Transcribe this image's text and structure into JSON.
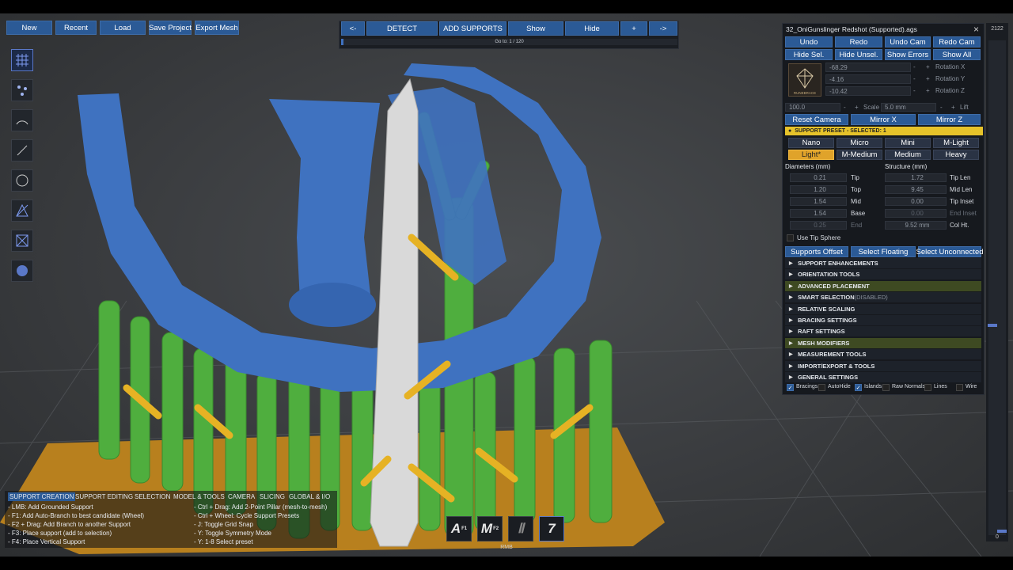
{
  "top_left_buttons": [
    "New",
    "Recent",
    "Load",
    "Save Project",
    "Export Mesh"
  ],
  "detect_bar": {
    "prev": "<-",
    "detect": "DETECT",
    "add_supports": "ADD SUPPORTS",
    "show": "Show",
    "hide": "Hide",
    "plus": "+",
    "next": "->",
    "goto": "Go to: 1 / 120",
    "progress": 0.008
  },
  "panel": {
    "title": "32_OniGunslinger Redshot (Supported).ags",
    "close": "×",
    "row1": [
      "Undo",
      "Redo",
      "Undo Cam",
      "Redo Cam"
    ],
    "row2": [
      "Hide Sel.",
      "Hide Unsel.",
      "Show Errors",
      "Show All"
    ],
    "logo_text": "RUNEBRACE",
    "rotation": [
      {
        "value": "-68.29",
        "label": "Rotation X"
      },
      {
        "value": "-4.16",
        "label": "Rotation Y"
      },
      {
        "value": "-10.42",
        "label": "Rotation Z"
      }
    ],
    "scale_value": "100.0",
    "scale_label": "Scale",
    "lift_value": "5.0 mm",
    "lift_label": "Lift",
    "minus": "-",
    "plus": "+",
    "camera_row": [
      "Reset Camera",
      "Mirror X",
      "Mirror Z"
    ],
    "preset_bar": "SUPPORT PRESET - SELECTED: 1",
    "presets_row1": [
      "Nano",
      "Micro",
      "Mini",
      "M-Light"
    ],
    "presets_row2": [
      "Light*",
      "M-Medium",
      "Medium",
      "Heavy"
    ],
    "selected_preset": "Light*",
    "diameters_header": "Diameters (mm)",
    "structure_header": "Structure (mm)",
    "diameters": [
      {
        "value": "0.21",
        "label": "Tip"
      },
      {
        "value": "1.20",
        "label": "Top"
      },
      {
        "value": "1.54",
        "label": "Mid"
      },
      {
        "value": "1.54",
        "label": "Base"
      },
      {
        "value": "0.25",
        "label": "End"
      }
    ],
    "structure": [
      {
        "value": "1.72",
        "label": "Tip Len"
      },
      {
        "value": "9.45",
        "label": "Mid Len"
      },
      {
        "value": "0.00",
        "label": "Tip Inset"
      },
      {
        "value": "0.00",
        "label": "End Inset"
      },
      {
        "value": "9.52 mm",
        "label": "Col Ht."
      }
    ],
    "use_tip_sphere": "Use Tip Sphere",
    "select_row": [
      "Supports Offset",
      "Select Floating",
      "Select Unconnected"
    ],
    "sections": [
      {
        "label": "SUPPORT ENHANCEMENTS",
        "green": false
      },
      {
        "label": "ORIENTATION TOOLS",
        "green": false
      },
      {
        "label": "ADVANCED PLACEMENT",
        "green": true
      },
      {
        "label": "SMART SELECTION",
        "suffix": "(DISABLED)",
        "green": false
      },
      {
        "label": "RELATIVE SCALING",
        "green": false
      },
      {
        "label": "BRACING SETTINGS",
        "green": false
      },
      {
        "label": "RAFT SETTINGS",
        "green": false
      },
      {
        "label": "MESH MODIFIERS",
        "green": true
      },
      {
        "label": "MEASUREMENT TOOLS",
        "green": false
      },
      {
        "label": "IMPORT/EXPORT & TOOLS",
        "green": false
      },
      {
        "label": "GENERAL SETTINGS",
        "green": false
      }
    ],
    "toggles": [
      {
        "label": "Bracings",
        "checked": true
      },
      {
        "label": "AutoHide",
        "checked": false
      },
      {
        "label": "Islands",
        "checked": true
      },
      {
        "label": "Raw Normals",
        "checked": false
      },
      {
        "label": "Lines",
        "checked": false
      },
      {
        "label": "Wire",
        "checked": false
      }
    ]
  },
  "scroll_strip": {
    "top": "2122",
    "bottom": "0"
  },
  "help": {
    "tabs": [
      "SUPPORT CREATION",
      "SUPPORT EDITING",
      "SELECTION",
      "MODEL & TOOLS",
      "CAMERA",
      "SLICING",
      "GLOBAL & I/O"
    ],
    "left": [
      "- LMB: Add Grounded Support",
      "- F1: Add Auto-Branch to best candidate (Wheel)",
      "- F2 + Drag: Add Branch to another Support",
      "- F3: Place support (add to selection)",
      "- F4: Place Vertical Support"
    ],
    "right": [
      "- Ctrl + Drag: Add 2-Point Pillar (mesh-to-mesh)",
      "- Ctrl + Wheel: Cycle Support Presets",
      "- J: Toggle Grid Snap",
      "- Y: Toggle Symmetry Mode",
      "- Y: 1-8 Select preset"
    ]
  },
  "hotkeys": [
    {
      "glyph": "A",
      "sub": "F1"
    },
    {
      "glyph": "M",
      "sub": "F2"
    },
    {
      "glyph": "Ⅱ",
      "sub": ""
    },
    {
      "glyph": "7",
      "sub": ""
    }
  ],
  "hotkey_caption": "RMB",
  "colors": {
    "support": "#4fae3e",
    "model": "#3f72c0",
    "brace": "#e6b224",
    "raft": "#b8801e",
    "accent": "#2b5a96"
  }
}
